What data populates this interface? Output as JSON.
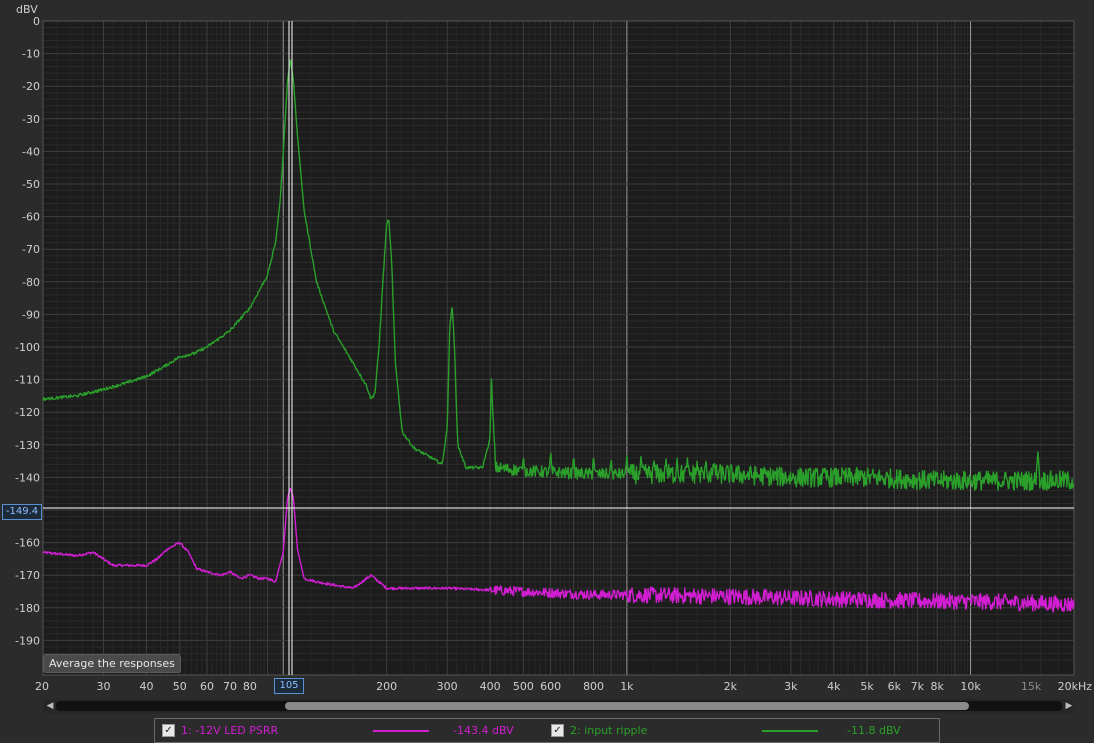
{
  "chart_data": {
    "type": "line",
    "title": "",
    "ylabel": "dBV",
    "xlabel": "",
    "x_scale": "log",
    "xlim": [
      20,
      20000
    ],
    "ylim": [
      -200,
      0
    ],
    "grid": true,
    "y_ticks": [
      "0",
      "-10",
      "-20",
      "-30",
      "-40",
      "-50",
      "-60",
      "-70",
      "-80",
      "-90",
      "-100",
      "-110",
      "-120",
      "-130",
      "-140",
      "-150",
      "-160",
      "-170",
      "-180",
      "-190"
    ],
    "x_ticks": [
      {
        "label": "20",
        "value": 20,
        "dim": false
      },
      {
        "label": "30",
        "value": 30,
        "dim": false
      },
      {
        "label": "40",
        "value": 40,
        "dim": false
      },
      {
        "label": "50",
        "value": 50,
        "dim": false
      },
      {
        "label": "60",
        "value": 60,
        "dim": false
      },
      {
        "label": "70",
        "value": 70,
        "dim": false
      },
      {
        "label": "80",
        "value": 80,
        "dim": false
      },
      {
        "label": "200",
        "value": 200,
        "dim": false
      },
      {
        "label": "300",
        "value": 300,
        "dim": false
      },
      {
        "label": "400",
        "value": 400,
        "dim": false
      },
      {
        "label": "500",
        "value": 500,
        "dim": false
      },
      {
        "label": "600",
        "value": 600,
        "dim": false
      },
      {
        "label": "800",
        "value": 800,
        "dim": false
      },
      {
        "label": "1k",
        "value": 1000,
        "dim": false
      },
      {
        "label": "2k",
        "value": 2000,
        "dim": false
      },
      {
        "label": "3k",
        "value": 3000,
        "dim": false
      },
      {
        "label": "4k",
        "value": 4000,
        "dim": false
      },
      {
        "label": "5k",
        "value": 5000,
        "dim": false
      },
      {
        "label": "6k",
        "value": 6000,
        "dim": false
      },
      {
        "label": "7k",
        "value": 7000,
        "dim": false
      },
      {
        "label": "8k",
        "value": 8000,
        "dim": false
      },
      {
        "label": "10k",
        "value": 10000,
        "dim": false
      },
      {
        "label": "15k",
        "value": 15000,
        "dim": true
      },
      {
        "label": "20kHz",
        "value": 20000,
        "dim": false
      }
    ],
    "cursor": {
      "x": 105,
      "y": -149.4,
      "x_label": "105",
      "y_label": "-149.4"
    },
    "series": [
      {
        "name": "1: -12V LED PSRR",
        "color": "#d21ed2",
        "cursor_value": "-143.4 dBV",
        "points": [
          [
            20,
            -163
          ],
          [
            25,
            -164
          ],
          [
            28,
            -163
          ],
          [
            32,
            -167
          ],
          [
            36,
            -167
          ],
          [
            40,
            -167
          ],
          [
            43,
            -165
          ],
          [
            46,
            -162
          ],
          [
            50,
            -160
          ],
          [
            53,
            -163
          ],
          [
            56,
            -168
          ],
          [
            60,
            -169
          ],
          [
            66,
            -170
          ],
          [
            70,
            -169
          ],
          [
            75,
            -171
          ],
          [
            80,
            -170
          ],
          [
            85,
            -171
          ],
          [
            90,
            -171
          ],
          [
            95,
            -172
          ],
          [
            100,
            -163
          ],
          [
            103,
            -146
          ],
          [
            105,
            -143.4
          ],
          [
            107,
            -146
          ],
          [
            110,
            -162
          ],
          [
            115,
            -171
          ],
          [
            125,
            -172
          ],
          [
            140,
            -173
          ],
          [
            160,
            -174
          ],
          [
            180,
            -170
          ],
          [
            200,
            -174
          ],
          [
            300,
            -174
          ],
          [
            500,
            -175
          ],
          [
            800,
            -176
          ],
          [
            1000,
            -176
          ],
          [
            2000,
            -176.5
          ],
          [
            3000,
            -177
          ],
          [
            5000,
            -177.5
          ],
          [
            8000,
            -178
          ],
          [
            10000,
            -178
          ],
          [
            15000,
            -178.5
          ],
          [
            20000,
            -179
          ]
        ],
        "noise": 2.5
      },
      {
        "name": "2: input ripple",
        "color": "#2aa02a",
        "cursor_value": "-11.8 dBV",
        "points": [
          [
            20,
            -116
          ],
          [
            25,
            -115
          ],
          [
            30,
            -113
          ],
          [
            35,
            -111
          ],
          [
            40,
            -109
          ],
          [
            45,
            -106
          ],
          [
            50,
            -103
          ],
          [
            55,
            -102
          ],
          [
            60,
            -100
          ],
          [
            70,
            -95
          ],
          [
            80,
            -88
          ],
          [
            90,
            -78
          ],
          [
            95,
            -68
          ],
          [
            98,
            -55
          ],
          [
            101,
            -33
          ],
          [
            103,
            -18
          ],
          [
            105,
            -11.8
          ],
          [
            107,
            -18
          ],
          [
            110,
            -35
          ],
          [
            115,
            -58
          ],
          [
            125,
            -80
          ],
          [
            140,
            -95
          ],
          [
            160,
            -105
          ],
          [
            175,
            -112
          ],
          [
            180,
            -116
          ],
          [
            185,
            -114
          ],
          [
            190,
            -100
          ],
          [
            195,
            -80
          ],
          [
            200,
            -62
          ],
          [
            203,
            -61
          ],
          [
            207,
            -75
          ],
          [
            212,
            -105
          ],
          [
            222,
            -126
          ],
          [
            240,
            -131
          ],
          [
            270,
            -134
          ],
          [
            290,
            -136
          ],
          [
            300,
            -125
          ],
          [
            305,
            -95
          ],
          [
            310,
            -87
          ],
          [
            315,
            -100
          ],
          [
            322,
            -130
          ],
          [
            340,
            -137
          ],
          [
            380,
            -137
          ],
          [
            400,
            -128
          ],
          [
            403,
            -109
          ],
          [
            407,
            -120
          ],
          [
            415,
            -137
          ],
          [
            500,
            -138
          ],
          [
            800,
            -139
          ],
          [
            1000,
            -139
          ],
          [
            2000,
            -139
          ],
          [
            3000,
            -140
          ],
          [
            5000,
            -140
          ],
          [
            8000,
            -141
          ],
          [
            10000,
            -141
          ],
          [
            15000,
            -141
          ],
          [
            20000,
            -141
          ]
        ],
        "harmonics": [
          [
            500,
            -133
          ],
          [
            600,
            -132
          ],
          [
            700,
            -133
          ],
          [
            800,
            -133
          ],
          [
            900,
            -134
          ],
          [
            1000,
            -133
          ],
          [
            1100,
            -133
          ],
          [
            1200,
            -134
          ],
          [
            1300,
            -134
          ],
          [
            1400,
            -134
          ],
          [
            1500,
            -134
          ],
          [
            1600,
            -135
          ],
          [
            1700,
            -135
          ],
          [
            1800,
            -135
          ],
          [
            15700,
            -132
          ]
        ],
        "noise": 3
      }
    ]
  },
  "average_button": "Average the responses",
  "legend": {
    "item1": {
      "label": "1: -12V LED PSRR",
      "value": "-143.4 dBV",
      "color": "#d21ed2",
      "checked": "✓"
    },
    "item2": {
      "label": "2: input ripple",
      "value": "-11.8 dBV",
      "color": "#2aa02a",
      "checked": "✓"
    }
  },
  "scroll": {
    "left": "◀",
    "right": "▶"
  }
}
